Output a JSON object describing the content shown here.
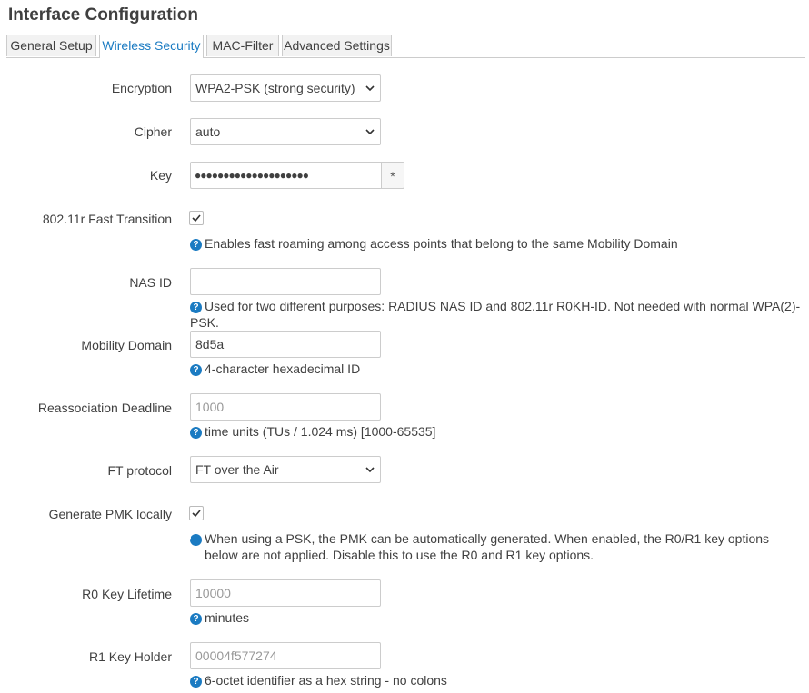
{
  "page": {
    "title": "Interface Configuration"
  },
  "tabs": [
    {
      "label": "General Setup"
    },
    {
      "label": "Wireless Security"
    },
    {
      "label": "MAC-Filter"
    },
    {
      "label": "Advanced Settings"
    }
  ],
  "form": {
    "encryption": {
      "label": "Encryption",
      "value": "WPA2-PSK (strong security)"
    },
    "cipher": {
      "label": "Cipher",
      "value": "auto"
    },
    "key": {
      "label": "Key",
      "value": "●●●●●●●●●●●●●●●●●●●●",
      "reveal": "*"
    },
    "fast_transition": {
      "label": "802.11r Fast Transition",
      "checked": true,
      "help": "Enables fast roaming among access points that belong to the same Mobility Domain"
    },
    "nas_id": {
      "label": "NAS ID",
      "value": "",
      "help": "Used for two different purposes: RADIUS NAS ID and 802.11r R0KH-ID. Not needed with normal WPA(2)-PSK."
    },
    "mobility_domain": {
      "label": "Mobility Domain",
      "value": "8d5a",
      "help": "4-character hexadecimal ID"
    },
    "reassoc_deadline": {
      "label": "Reassociation Deadline",
      "placeholder": "1000",
      "help": "time units (TUs / 1.024 ms) [1000-65535]"
    },
    "ft_protocol": {
      "label": "FT protocol",
      "value": "FT over the Air"
    },
    "pmk_local": {
      "label": "Generate PMK locally",
      "checked": true,
      "help": "When using a PSK, the PMK can be automatically generated. When enabled, the R0/R1 key options below are not applied. Disable this to use the R0 and R1 key options."
    },
    "r0_lifetime": {
      "label": "R0 Key Lifetime",
      "placeholder": "10000",
      "help": "minutes"
    },
    "r1_holder": {
      "label": "R1 Key Holder",
      "placeholder": "00004f577274",
      "help": "6-octet identifier as a hex string - no colons"
    }
  },
  "icons": {
    "help": "help-circle-icon",
    "check": "check-icon",
    "chevron": "chevron-down-icon"
  },
  "colors": {
    "accent": "#1b7bc2",
    "text": "#404040",
    "border": "#cccccc"
  }
}
